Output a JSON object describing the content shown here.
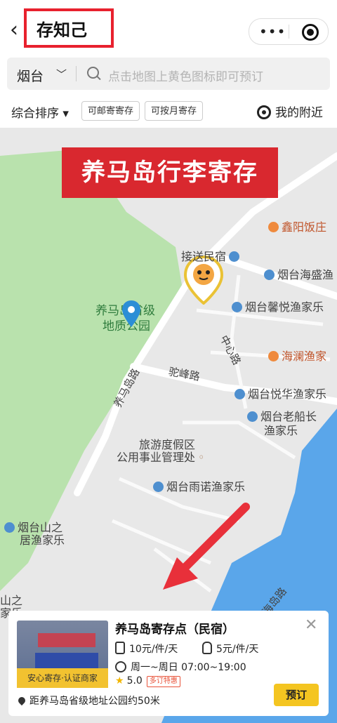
{
  "header": {
    "back_icon": "chevron-left-icon",
    "title": "存知己",
    "menu_icon": "more-dots-icon",
    "close_icon": "target-icon"
  },
  "search": {
    "city": "烟台",
    "placeholder": "点击地图上黄色图标即可预订"
  },
  "filters": {
    "sort_label": "综合排序 ▾",
    "chip_mail": "可邮寄寄存",
    "chip_month": "可按月寄存",
    "nearby": "我的附近"
  },
  "map": {
    "banner": "养马岛行李寄存",
    "park_label_1": "养马岛省级",
    "park_label_2": "地质公园",
    "road_1": "养马岛路",
    "road_2": "驼峰路",
    "road_3": "中心路",
    "road_4": "海岛路",
    "pois": [
      {
        "label": "鑫阳饭庄",
        "kind": "restaurant"
      },
      {
        "label": "接送民宿",
        "kind": "hotel"
      },
      {
        "label": "烟台海盛渔",
        "kind": "hotel"
      },
      {
        "label": "烟台馨悦渔家乐",
        "kind": "hotel"
      },
      {
        "label": "海澜渔家",
        "kind": "restaurant"
      },
      {
        "label": "烟台悦华渔家乐",
        "kind": "hotel"
      },
      {
        "label": "烟台老船长",
        "kind": "hotel"
      },
      {
        "label": "渔家乐",
        "kind": "hotel"
      },
      {
        "label": "旅游度假区",
        "kind": "office"
      },
      {
        "label": "公用事业管理处",
        "kind": "office"
      },
      {
        "label": "烟台雨诺渔家乐",
        "kind": "hotel"
      },
      {
        "label": "烟台山之",
        "kind": "hotel"
      },
      {
        "label": "居渔家乐",
        "kind": "hotel"
      },
      {
        "label": "山之",
        "kind": "hotel"
      },
      {
        "label": "家乐",
        "kind": "hotel"
      }
    ]
  },
  "card": {
    "badge": "安心寄存·认证商家",
    "title": "养马岛寄存点（民宿）",
    "price_1": "10元/件/天",
    "price_2": "5元/件/天",
    "hours": "周一~周日 07:00~19:00",
    "rating": "5.0",
    "promo": "多订特惠",
    "distance": "距养马岛省级地址公园约50米",
    "book": "预订"
  },
  "colors": {
    "accent": "#f4c521",
    "banner": "#d9282f",
    "park": "#b9e2ad",
    "water": "#5aa6ea"
  }
}
